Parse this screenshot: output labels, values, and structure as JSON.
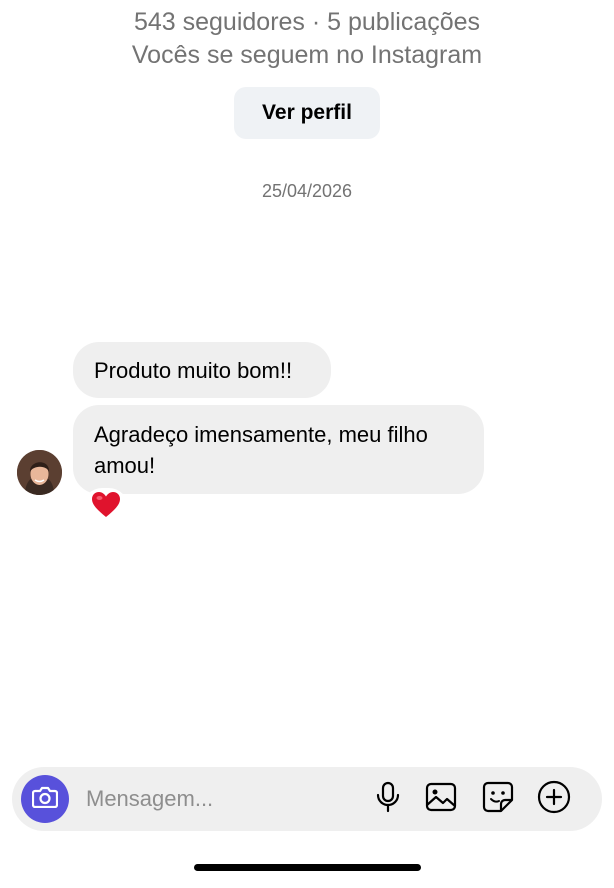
{
  "profile": {
    "stats": "543 seguidores · 5 publicações",
    "mutual": "Vocês se seguem no Instagram",
    "view_profile_label": "Ver perfil"
  },
  "thread": {
    "date": "25/04/2026",
    "messages": [
      {
        "text": "Produto muito bom!!"
      },
      {
        "text": "Agradeço imensamente, meu filho amou!",
        "reaction": "❤️"
      }
    ]
  },
  "composer": {
    "placeholder": "Mensagem...",
    "camera_icon": "camera-icon",
    "tools": [
      "microphone-icon",
      "gallery-icon",
      "sticker-icon",
      "add-icon"
    ],
    "accent_color": "#5851db"
  }
}
